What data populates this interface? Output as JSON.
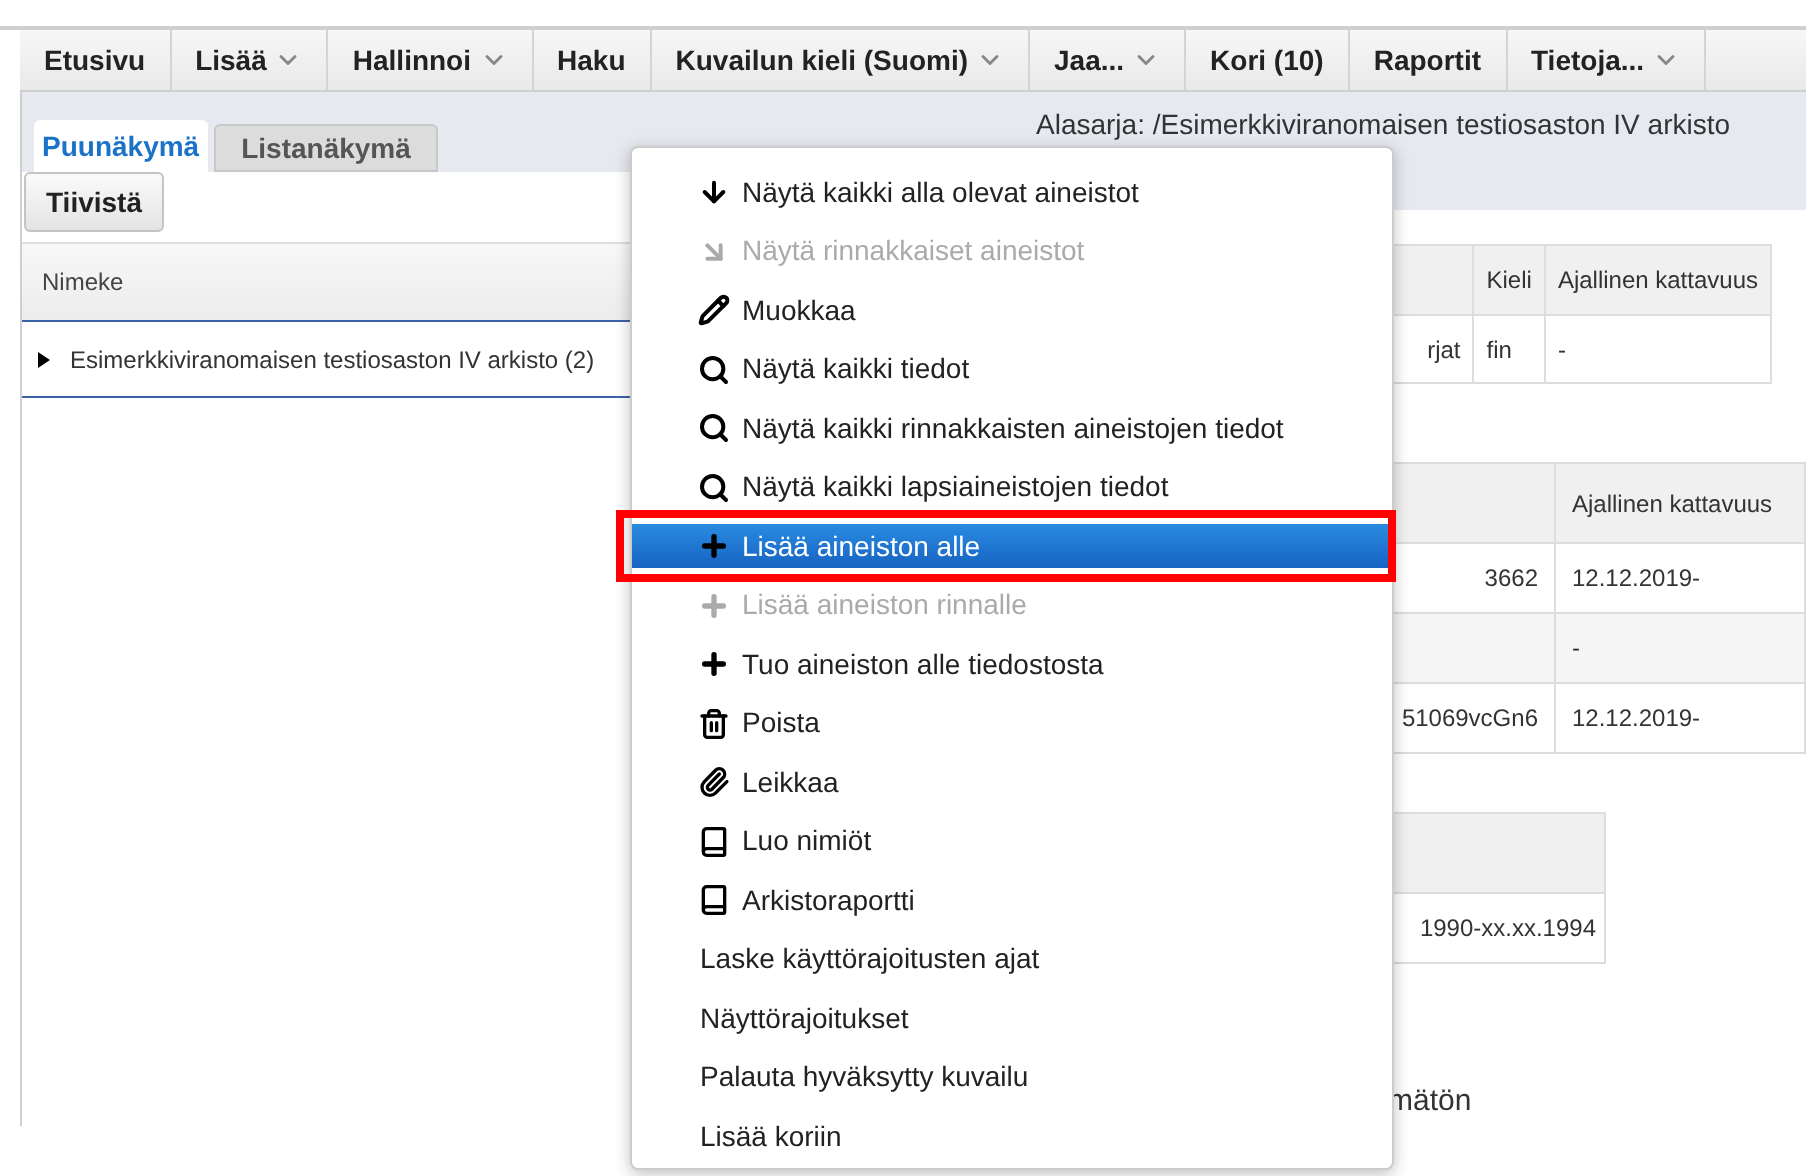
{
  "nav": [
    {
      "label": "Etusivu",
      "dropdown": false
    },
    {
      "label": "Lisää",
      "dropdown": true
    },
    {
      "label": "Hallinnoi",
      "dropdown": true
    },
    {
      "label": "Haku",
      "dropdown": false
    },
    {
      "label": "Kuvailun kieli (Suomi)",
      "dropdown": true
    },
    {
      "label": "Jaa...",
      "dropdown": true
    },
    {
      "label": "Kori (10)",
      "dropdown": false
    },
    {
      "label": "Raportit",
      "dropdown": false
    },
    {
      "label": "Tietoja...",
      "dropdown": true
    }
  ],
  "tabs": [
    {
      "label": "Puunäkymä",
      "selected": true
    },
    {
      "label": "Listanäkymä",
      "selected": false
    }
  ],
  "collapse_button": "Tiivistä",
  "tree": {
    "column": "Nimeke",
    "rows": [
      {
        "label": "Esimerkkiviranomaisen testiosaston IV arkisto (2)",
        "expanded": false
      }
    ]
  },
  "breadcrumb": "Alasarja: /Esimerkkiviranomaisen testiosaston IV arkisto",
  "table_1": {
    "columns": [
      "",
      "Kieli",
      "Ajallinen kattavuus"
    ],
    "rows": [
      [
        "rjat",
        "fin",
        "-"
      ]
    ]
  },
  "table_2": {
    "columns": [
      "",
      "Ajallinen kattavuus"
    ],
    "rows": [
      [
        "3662",
        "12.12.2019-"
      ],
      [
        "",
        "-"
      ],
      [
        "51069vcGn6",
        "12.12.2019-"
      ]
    ]
  },
  "table_3": {
    "rows": [
      [
        "1990-xx.xx.1994"
      ]
    ]
  },
  "fragment": "mätön",
  "context_menu": [
    {
      "label": "Näytä kaikki alla olevat aineistot",
      "kind": "arrow-down",
      "disabled": false,
      "selected": false
    },
    {
      "label": "Näytä rinnakkaiset aineistot",
      "kind": "arrow-down-right",
      "disabled": true,
      "selected": false
    },
    {
      "label": "Muokkaa",
      "kind": "pencil",
      "disabled": false,
      "selected": false
    },
    {
      "label": "Näytä kaikki tiedot",
      "kind": "search",
      "disabled": false,
      "selected": false
    },
    {
      "label": "Näytä kaikki rinnakkaisten aineistojen tiedot",
      "kind": "search",
      "disabled": false,
      "selected": false
    },
    {
      "label": "Näytä kaikki lapsiaineistojen tiedot",
      "kind": "search",
      "disabled": false,
      "selected": false
    },
    {
      "label": "Lisää aineiston alle",
      "kind": "plus",
      "disabled": false,
      "selected": true
    },
    {
      "label": "Lisää aineiston rinnalle",
      "kind": "plus",
      "disabled": true,
      "selected": false
    },
    {
      "label": "Tuo aineiston alle tiedostosta",
      "kind": "plus",
      "disabled": false,
      "selected": false
    },
    {
      "label": "Poista",
      "kind": "trash",
      "disabled": false,
      "selected": false
    },
    {
      "label": "Leikkaa",
      "kind": "paperclip",
      "disabled": false,
      "selected": false
    },
    {
      "label": "Luo nimiöt",
      "kind": "book",
      "disabled": false,
      "selected": false
    },
    {
      "label": "Arkistoraportti",
      "kind": "book",
      "disabled": false,
      "selected": false
    },
    {
      "label": "Laske käyttörajoitusten ajat",
      "kind": "text",
      "disabled": false,
      "selected": false
    },
    {
      "label": "Näyttörajoitukset",
      "kind": "text",
      "disabled": false,
      "selected": false
    },
    {
      "label": "Palauta hyväksytty kuvailu",
      "kind": "text",
      "disabled": false,
      "selected": false
    },
    {
      "label": "Lisää koriin",
      "kind": "text",
      "disabled": false,
      "selected": false
    }
  ]
}
